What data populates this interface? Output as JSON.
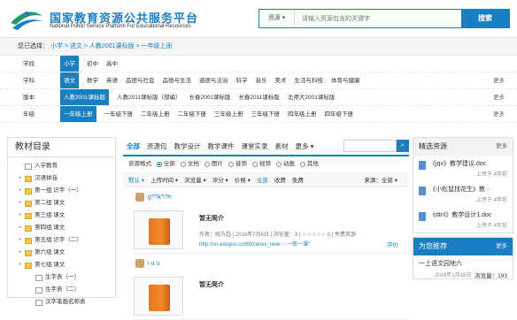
{
  "header": {
    "title": "国家教育资源公共服务平台",
    "subtitle": "National Public Service Platform For Educational Resources",
    "search_scope": "资源",
    "search_placeholder": "请输入资源包含的关键字",
    "search_button": "搜索"
  },
  "breadcrumb": {
    "label": "您已选择：",
    "path": "小学 > 语文 > 人教2001课标版 > 一年级上册"
  },
  "filters": {
    "more": "更多",
    "stage": {
      "key": "学段:",
      "options": [
        "小学",
        "初中",
        "高中"
      ],
      "selected": 0
    },
    "subject": {
      "key": "学科:",
      "options": [
        "语文",
        "数学",
        "英语",
        "品德与社会",
        "品德与生活",
        "道德与法治",
        "科学",
        "音乐",
        "美术",
        "生活与科技",
        "体育与健康"
      ],
      "selected": 0
    },
    "edition": {
      "key": "版本:",
      "options": [
        "人教2001课标版",
        "人教2011课标版（部编）",
        "长春2001课标版",
        "长春2011课标版",
        "北师大2001课标版"
      ],
      "selected": 0
    },
    "grade": {
      "key": "年级:",
      "options": [
        "一年级上册",
        "一年级下册",
        "二年级上册",
        "二年级下册",
        "三年级上册",
        "三年级下册",
        "四年级上册",
        "四年级下册"
      ],
      "selected": 0
    }
  },
  "catalog": {
    "title": "教材目录",
    "nodes": [
      {
        "pm": "",
        "label": "入学教育",
        "type": "doc",
        "indent": false
      },
      {
        "pm": "+",
        "label": "汉语拼音",
        "type": "folder",
        "indent": false
      },
      {
        "pm": "+",
        "label": "第一组 识字（一）",
        "type": "folder",
        "indent": false
      },
      {
        "pm": "+",
        "label": "第二组 课文",
        "type": "folder",
        "indent": false
      },
      {
        "pm": "+",
        "label": "第三组 课文",
        "type": "folder",
        "indent": false
      },
      {
        "pm": "+",
        "label": "第四组 课文",
        "type": "folder",
        "indent": false
      },
      {
        "pm": "+",
        "label": "第五组 识字（二）",
        "type": "folder",
        "indent": false
      },
      {
        "pm": "+",
        "label": "第六组 课文",
        "type": "folder",
        "indent": false
      },
      {
        "pm": "+",
        "label": "第七组 课文",
        "type": "folder",
        "indent": false
      },
      {
        "pm": "",
        "label": "生字表（一）",
        "type": "doc",
        "indent": true
      },
      {
        "pm": "",
        "label": "生字表（二）",
        "type": "doc",
        "indent": true
      },
      {
        "pm": "",
        "label": "汉字笔画名称表",
        "type": "doc",
        "indent": true
      }
    ]
  },
  "tabs": [
    "全部",
    "资源包",
    "教学设计",
    "教学课件",
    "课堂实录",
    "素材",
    "更多 ▾"
  ],
  "format": {
    "label": "资源格式:",
    "options": [
      "全部",
      "文档",
      "图片",
      "音频",
      "视频",
      "动画",
      "其他"
    ],
    "selected": 0
  },
  "sort": {
    "items": [
      "默认 ▾",
      "上传时间 ▾",
      "浏览量 ▾",
      "评分 ▾",
      "价格 ▾",
      "全部",
      "收费",
      "免费"
    ],
    "source": "来源：全部 ▾"
  },
  "results": [
    {
      "header": "g??k??h",
      "title": "暂无简介",
      "meta": "作者：姚万超 | 2016年7月6日 | 浏览量：3 | ☆☆☆☆☆ 0 | 免费资源",
      "url": "http://so.eduyun.cn/80/ceries_new-···一般一课\"",
      "rate": "评价"
    },
    {
      "header": "i u ü",
      "title": "暂无简介",
      "meta": "",
      "url": "",
      "rate": ""
    }
  ],
  "featured": {
    "title": "精选资源",
    "more": "更多",
    "items": [
      {
        "title": "《jqx》教学建议.doc",
        "date": "上传于 4年前"
      },
      {
        "title": "《小松鼠找花生》教···",
        "date": "上传于 4年前"
      },
      {
        "title": "《dtnl》教学设计1.doc",
        "date": "上传于 4年前"
      }
    ]
  },
  "recommend": {
    "title": "为您推荐",
    "more": "更多",
    "items": [
      {
        "title": "一上语文园地六",
        "date": "2018年1月18日",
        "views": "浏览量：193"
      }
    ]
  }
}
